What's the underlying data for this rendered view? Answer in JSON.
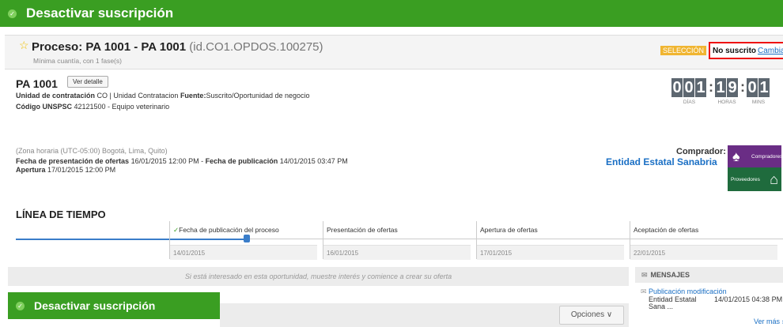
{
  "subscription_bar": {
    "label": "Desactivar suscripción",
    "check_icon": "✓"
  },
  "process": {
    "title": "Proceso: PA 1001 - PA 1001",
    "id_text": "(id.CO1.OPDOS.100275)",
    "subtitle": "Mínima cuantía, con 1 fase(s)",
    "phase_badge": "SELECCIÓN",
    "subscription_status": "No suscrito",
    "change_link": "Cambiar"
  },
  "summary": {
    "code": "PA 1001",
    "detail_button": "Ver detalle",
    "unit_label": "Unidad de contratación",
    "unit_value": "CO | Unidad Contratacion",
    "source_label": "Fuente:",
    "source_value": "Suscrito/Oportunidad de negocio",
    "unspsc_label": "Código UNSPSC",
    "unspsc_value": "42121500 - Equipo veterinario"
  },
  "timer": {
    "days": "001",
    "hours": "19",
    "mins": "01",
    "days_label": "DÍAS",
    "hours_label": "HORAS",
    "mins_label": "MINS"
  },
  "dates": {
    "zone": "(Zona horaria (UTC-05:00) Bogotá, Lima, Quito)",
    "presentation_label": "Fecha de presentación de ofertas",
    "presentation_value": "16/01/2015 12:00 PM",
    "separator": "-",
    "publication_label": "Fecha de publicación",
    "publication_value": "14/01/2015 03:47 PM",
    "opening_label": "Apertura",
    "opening_value": "17/01/2015 12:00 PM"
  },
  "buyer": {
    "label": "Comprador:",
    "name": "Entidad Estatal Sanabria",
    "logo_top": "Compradores",
    "logo_bottom": "Proveedores"
  },
  "timeline": {
    "title": "LÍNEA DE TIEMPO",
    "steps": [
      {
        "label": "Fecha de publicación del proceso",
        "date": "14/01/2015",
        "done": "✓"
      },
      {
        "label": "Presentación de ofertas",
        "date": "16/01/2015"
      },
      {
        "label": "Apertura de ofertas",
        "date": "17/01/2015"
      },
      {
        "label": "Aceptación de ofertas",
        "date": "22/01/2015"
      }
    ]
  },
  "interest_text": "Si está interesado en esta oportunidad, muestre interés y comience a crear su oferta",
  "messages": {
    "header": "MENSAJES",
    "item_title": "Publicación modificación",
    "item_sender_line1": "Entidad Estatal",
    "item_sender_line2": "Sana ...",
    "item_date": "14/01/2015 04:38 PM",
    "more_link": "Ver más ›"
  },
  "options_button": "Opciones ∨",
  "colors": {
    "green": "#3a9e22",
    "blue_link": "#1a6fc4",
    "badge_orange": "#f0b531",
    "timer_gray": "#5d6770",
    "highlight_red": "#ee1111"
  }
}
